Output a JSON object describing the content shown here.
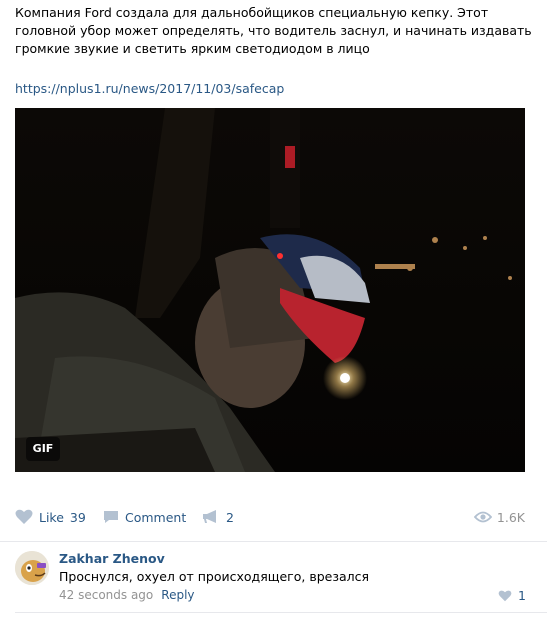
{
  "post": {
    "text": "Компания Ford создала для дальнобойщиков специальную кепку. Этот головной убор может определять, что водитель заснул, и начинать издавать громкие звукие и светить ярким светодиодом в лицо",
    "link": "https://nplus1.ru/news/2017/11/03/safecap",
    "media_badge": "GIF"
  },
  "actions": {
    "like_label": "Like",
    "like_count": "39",
    "comment_label": "Comment",
    "share_count": "2",
    "views_count": "1.6K"
  },
  "comment": {
    "author": "Zakhar Zhenov",
    "text": "Проснулся, охуел от происходящего, врезался",
    "time": "42 seconds ago",
    "reply_label": "Reply",
    "like_count": "1"
  },
  "colors": {
    "link": "#2a5885",
    "muted": "#939393",
    "icon": "#b3c1d1"
  }
}
